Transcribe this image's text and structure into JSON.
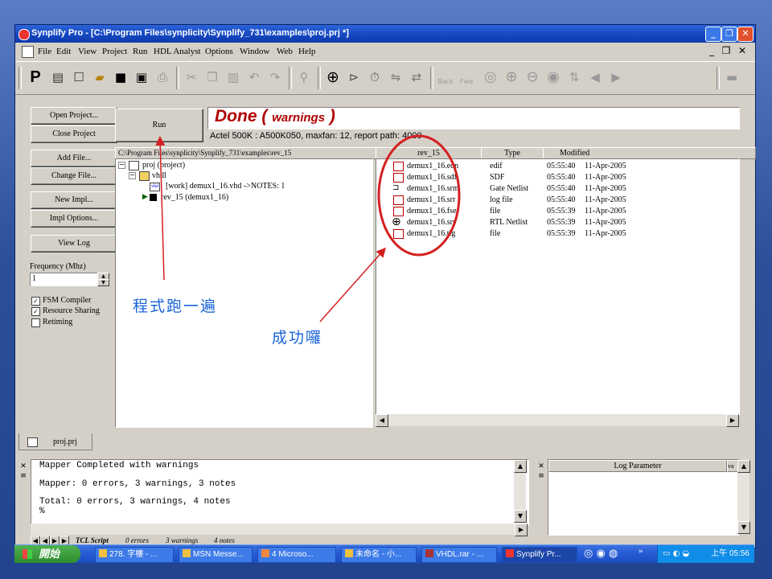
{
  "window": {
    "title": "Synplify Pro - [C:\\Program Files\\synplicity\\Synplify_731\\examples\\proj.prj *]",
    "controls": [
      "_",
      "❐",
      "✕"
    ]
  },
  "menu": {
    "items": [
      "File",
      "Edit",
      "View",
      "Project",
      "Run",
      "HDL Analyst",
      "Options",
      "Window",
      "Web",
      "Help"
    ],
    "mdi_controls": [
      "_",
      "❐",
      "✕"
    ]
  },
  "toolbar": {
    "back_label": "Back",
    "fwd_label": "Fwd"
  },
  "left_buttons": {
    "open_project": "Open Project...",
    "close_project": "Close Project",
    "add_file": "Add File...",
    "change_file": "Change File...",
    "new_impl": "New Impl...",
    "impl_options": "Impl Options...",
    "view_log": "View Log",
    "frequency_label": "Frequency (Mhz)",
    "frequency_value": "1",
    "fsm_compiler": "FSM Compiler",
    "resource_sharing": "Resource Sharing",
    "retiming": "Retiming",
    "fsm_checked": "✓",
    "resource_checked": "✓"
  },
  "run": {
    "label": "Run",
    "status_done": "Done",
    "status_paren_open": "(",
    "status_warn": "warnings",
    "status_paren_close": ")",
    "info": "Actel 500K : A500K050,  maxfan: 12,  report path: 4000"
  },
  "project_tree": {
    "path": "C:\\Program Files\\synplicity\\Synplify_731\\examples\\rev_15",
    "nodes": [
      "proj (project)",
      "vhdl",
      "[work] demux1_16.vhd ->NOTES: 1",
      "rev_15    (demux1_16)"
    ],
    "vhd_badge": "vhd"
  },
  "file_list": {
    "headers": [
      "rev_15",
      "Type",
      "Modified"
    ],
    "rows": [
      {
        "name": "demux1_16.edn",
        "type": "edif",
        "time": "05:55:40",
        "date": "11-Apr-2005"
      },
      {
        "name": "demux1_16.sdf",
        "type": "SDF",
        "time": "05:55:40",
        "date": "11-Apr-2005"
      },
      {
        "name": "demux1_16.srm",
        "type": "Gate Netlist",
        "time": "05:55:40",
        "date": "11-Apr-2005"
      },
      {
        "name": "demux1_16.srr",
        "type": "log file",
        "time": "05:55:40",
        "date": "11-Apr-2005"
      },
      {
        "name": "demux1_16.fse",
        "type": "file",
        "time": "05:55:39",
        "date": "11-Apr-2005"
      },
      {
        "name": "demux1_16.srs",
        "type": "RTL Netlist",
        "time": "05:55:39",
        "date": "11-Apr-2005"
      },
      {
        "name": "demux1_16.tlg",
        "type": "file",
        "time": "05:55:39",
        "date": "11-Apr-2005"
      }
    ]
  },
  "tabs": {
    "project_tab": "proj.prj"
  },
  "log": {
    "lines": [
      "Mapper Completed with warnings",
      "Mapper: 0 errors, 3 warnings, 3 notes",
      "Total: 0 errors, 3 warnings, 4 notes",
      "%"
    ],
    "tabs": [
      "TCL Script",
      "0 errors",
      "3 warnings",
      "4 notes"
    ]
  },
  "log_param": {
    "header": "Log Parameter",
    "header2": "va"
  },
  "taskbar": {
    "start": "開始",
    "items": [
      "278. 字樓 - ...",
      "MSN Messe...",
      "4 Microso...",
      "未命名 - 小...",
      "VHDL.rar - ...",
      "Synplify Pr..."
    ],
    "clock": "上午 05:56",
    "overflow": "»"
  },
  "annotations": {
    "run_note": "程式跑一遍",
    "done_note": "成功囉"
  },
  "colors": {
    "title_bar": "#1446c0",
    "done_text": "#b00000",
    "annotation": "#1a64d8",
    "arrow": "#d42020"
  }
}
